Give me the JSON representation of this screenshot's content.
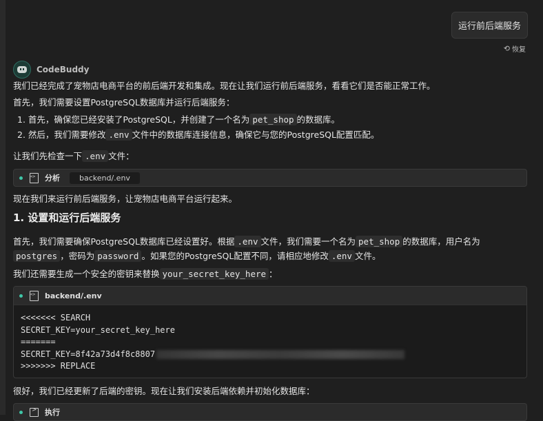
{
  "user_message": "运行前后端服务",
  "restore_label": "恢复",
  "agent_name": "CodeBuddy",
  "intro": "我们已经完成了宠物店电商平台的前后端开发和集成。现在让我们运行前后端服务，看看它们是否能正常工作。",
  "first_para": "首先，我们需要设置PostgreSQL数据库并运行后端服务：",
  "list": [
    {
      "n": "1.",
      "a": "首先，确保您已经安装了PostgreSQL，并创建了一个名为",
      "code": "pet_shop",
      "b": "的数据库。"
    },
    {
      "n": "2.",
      "a": "然后，我们需要修改",
      "code": ".env",
      "b": "文件中的数据库连接信息，确保它与您的PostgreSQL配置匹配。"
    }
  ],
  "check_env": {
    "a": "让我们先检查一下",
    "code": ".env",
    "b": "文件："
  },
  "tool1": {
    "label": "分析",
    "path": "backend/.env"
  },
  "run_services": "现在我们来运行前后端服务，让宠物店电商平台运行起来。",
  "heading": "1. 设置和运行后端服务",
  "para_db": {
    "l1a": "首先，我们需要确保PostgreSQL数据库已经设置好。根据",
    "c1": ".env",
    "l1b": "文件，我们需要一个名为",
    "c2": "pet_shop",
    "l1c": "的数据库，用户名为",
    "c3": "postgres",
    "l2a": "，密码为",
    "c4": "password",
    "l2b": "。如果您的PostgreSQL配置不同，请相应地修改",
    "c5": ".env",
    "l2c": "文件。"
  },
  "secret_para": {
    "a": "我们还需要生成一个安全的密钥来替换",
    "code": "your_secret_key_here",
    "b": "："
  },
  "code_block": {
    "file": "backend/.env",
    "lines": [
      "<<<<<<< SEARCH",
      "SECRET_KEY=your_secret_key_here",
      "=======",
      "SECRET_KEY=8f42a73d4f8c8807",
      ">>>>>>> REPLACE"
    ]
  },
  "after_para": "很好，我们已经更新了后端的密钥。现在让我们安装后端依赖并初始化数据库：",
  "tool2": {
    "label": "执行"
  }
}
